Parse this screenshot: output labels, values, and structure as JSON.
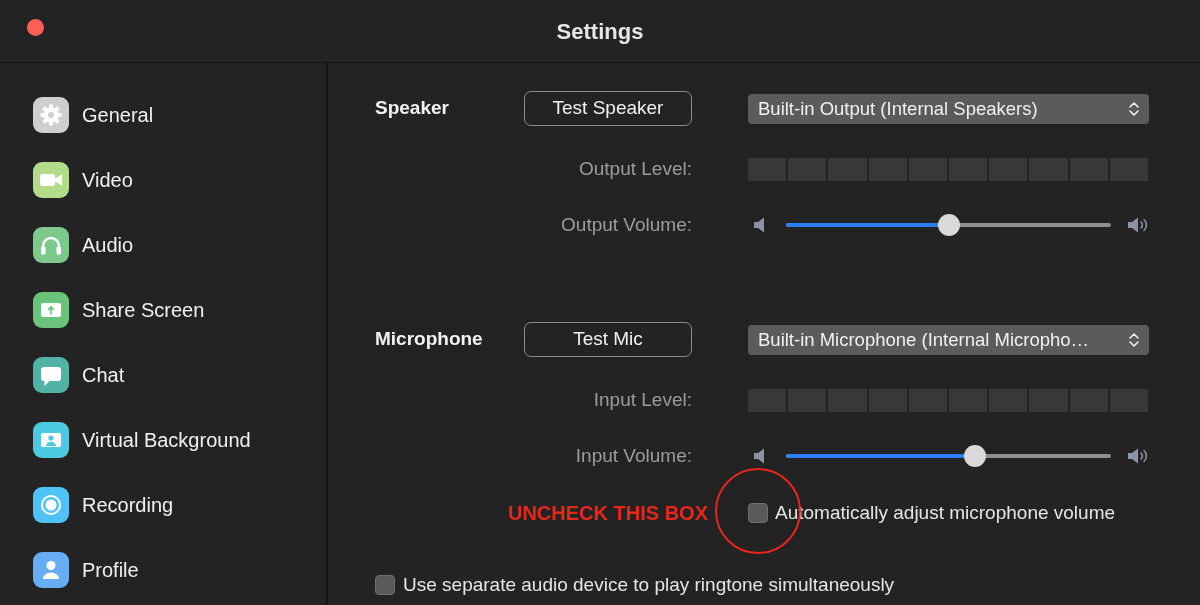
{
  "window": {
    "title": "Settings"
  },
  "sidebar": {
    "items": [
      {
        "label": "General",
        "kind": "gear",
        "color": "#cfcfcf"
      },
      {
        "label": "Video",
        "kind": "video",
        "color": "#b3dc8a"
      },
      {
        "label": "Audio",
        "kind": "headphones",
        "color": "#7dc88b"
      },
      {
        "label": "Share Screen",
        "kind": "share",
        "color": "#6bc27b"
      },
      {
        "label": "Chat",
        "kind": "chat",
        "color": "#51b3a6"
      },
      {
        "label": "Virtual Background",
        "kind": "background",
        "color": "#4ccbe0"
      },
      {
        "label": "Recording",
        "kind": "record",
        "color": "#4fc3f7"
      },
      {
        "label": "Profile",
        "kind": "profile",
        "color": "#66adf4"
      }
    ]
  },
  "audio": {
    "sections": [
      {
        "heading": "Speaker",
        "test_button": "Test Speaker",
        "device": "Built-in Output (Internal Speakers)",
        "level_label": "Output Level:",
        "volume_label": "Output Volume:",
        "volume": {
          "level": 0.5
        }
      },
      {
        "heading": "Microphone",
        "test_button": "Test Mic",
        "device": "Built-in Microphone (Internal Micropho…",
        "level_label": "Input Level:",
        "volume_label": "Input Volume:",
        "volume": {
          "level": 0.58
        }
      }
    ],
    "auto_adjust": {
      "label": "Automatically adjust microphone volume",
      "checked": false
    },
    "annotation": {
      "text": "UNCHECK THIS BOX"
    },
    "ringtone_option": {
      "label": "Use separate audio device to play ringtone simultaneously",
      "checked": false
    }
  }
}
